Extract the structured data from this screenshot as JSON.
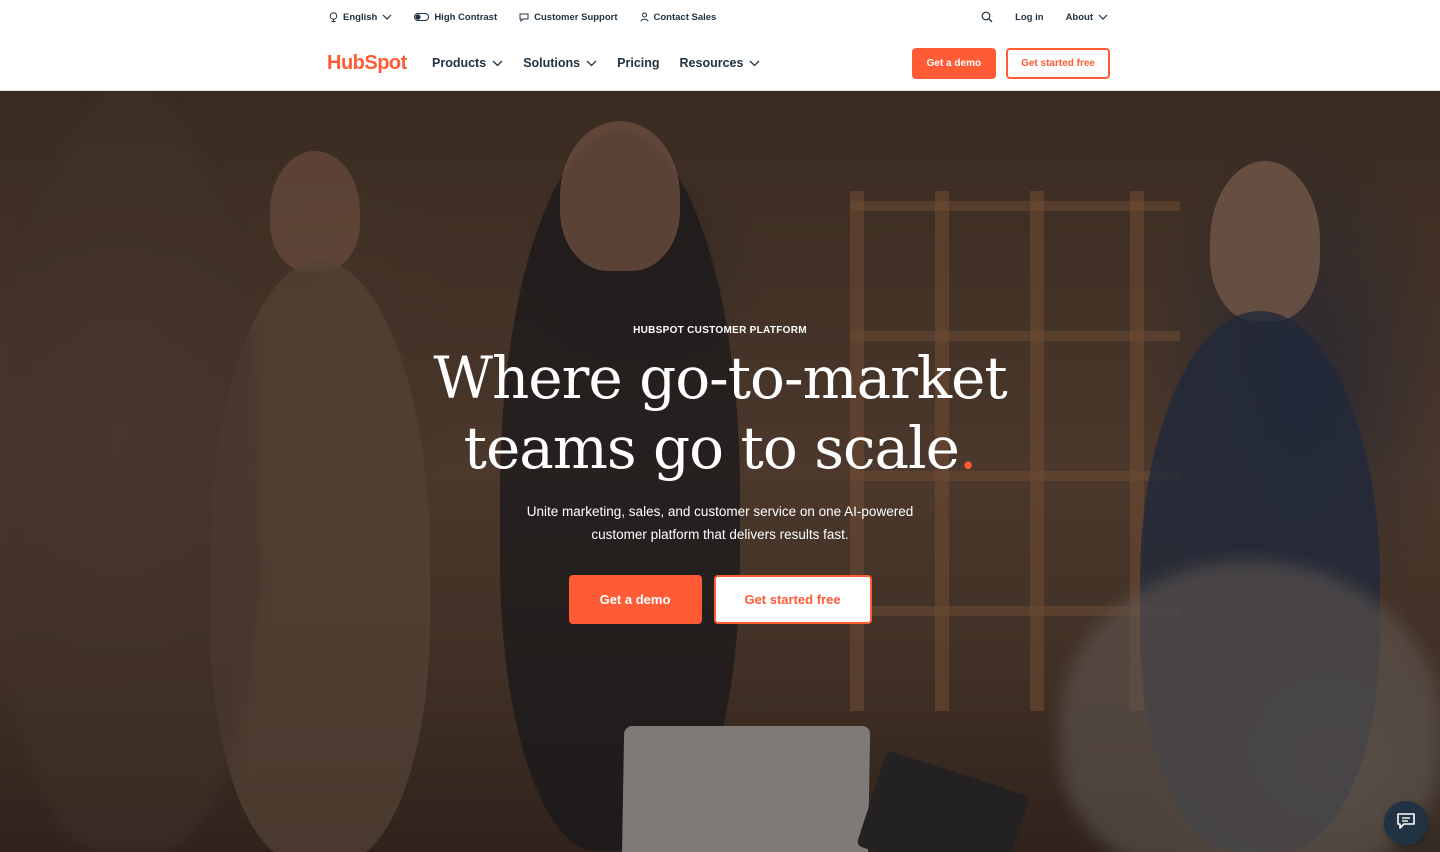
{
  "utility": {
    "language": "English",
    "high_contrast": "High Contrast",
    "customer_support": "Customer Support",
    "contact_sales": "Contact Sales",
    "login": "Log in",
    "about": "About"
  },
  "nav": {
    "logo": "HubSpot",
    "items": [
      {
        "label": "Products",
        "dropdown": true
      },
      {
        "label": "Solutions",
        "dropdown": true
      },
      {
        "label": "Pricing",
        "dropdown": false
      },
      {
        "label": "Resources",
        "dropdown": true
      }
    ],
    "cta_demo": "Get a demo",
    "cta_free": "Get started free"
  },
  "hero": {
    "eyebrow": "HUBSPOT CUSTOMER PLATFORM",
    "headline_line1": "Where go-to-market",
    "headline_line2": "teams go to scale",
    "headline_dot": ".",
    "subtext": "Unite marketing, sales, and customer service on one AI-powered customer platform that delivers results fast.",
    "cta_demo": "Get a demo",
    "cta_free": "Get started free"
  },
  "colors": {
    "brand": "#ff5c35",
    "text": "#213343"
  },
  "icons": {
    "language": "globe-icon",
    "contrast": "contrast-toggle-icon",
    "support": "chat-bubble-icon",
    "sales": "person-icon",
    "search": "search-icon",
    "chat": "chat-widget-icon"
  }
}
